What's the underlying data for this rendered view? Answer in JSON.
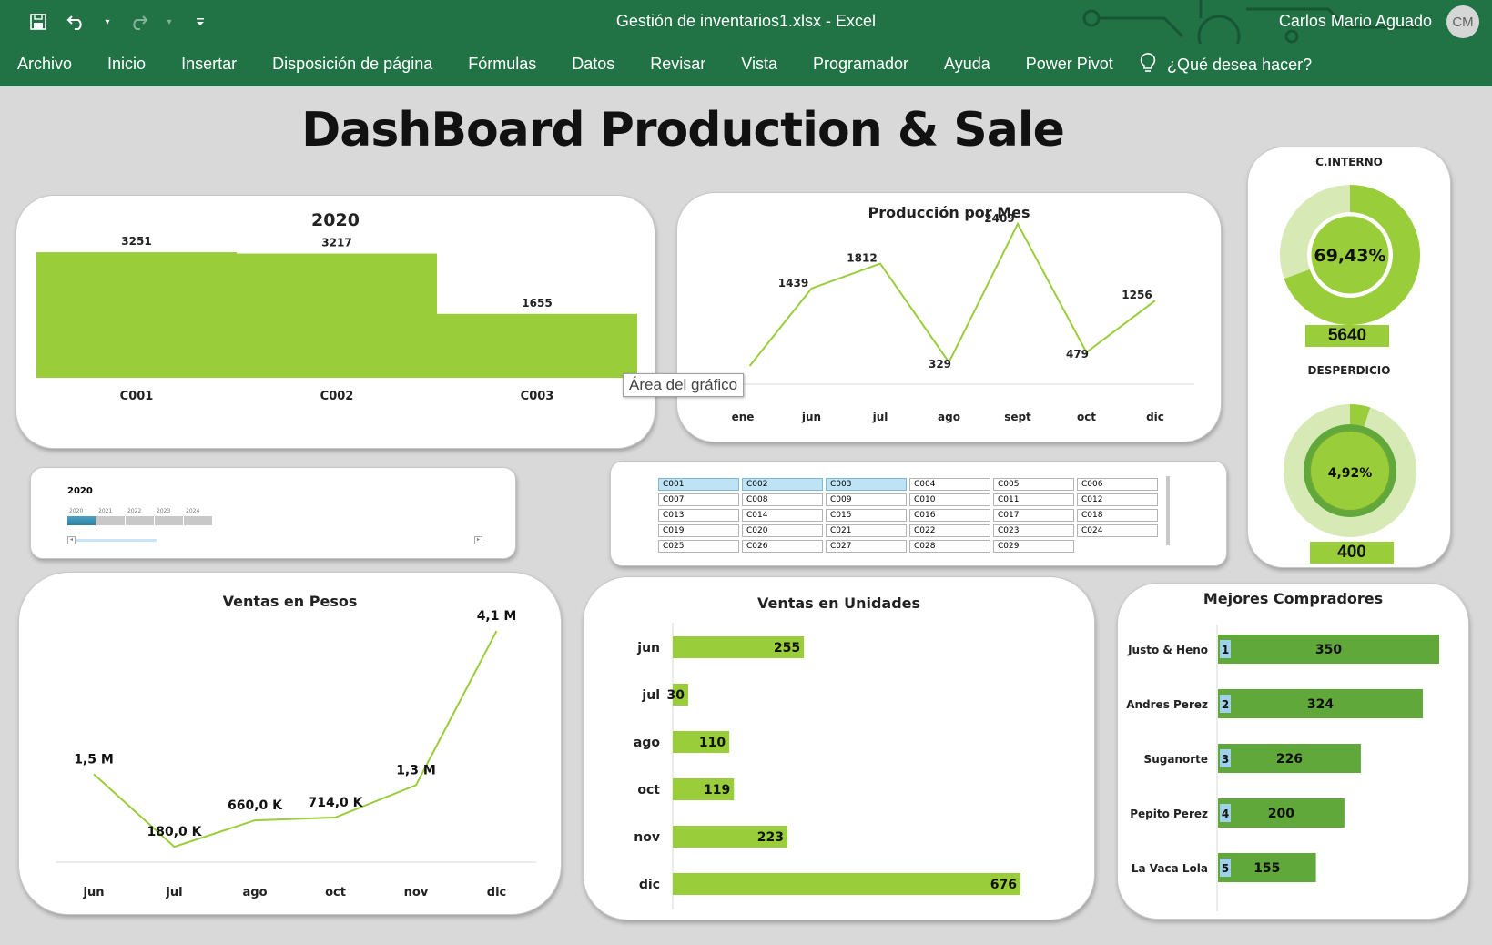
{
  "window": {
    "title": "Gestión de inventarios1.xlsx  -  Excel",
    "user": "Carlos Mario Aguado",
    "avatar": "CM"
  },
  "ribbon": {
    "tabs": [
      "Archivo",
      "Inicio",
      "Insertar",
      "Disposición de página",
      "Fórmulas",
      "Datos",
      "Revisar",
      "Vista",
      "Programador",
      "Ayuda",
      "Power Pivot"
    ],
    "tell_me": "¿Qué desea hacer?"
  },
  "icons": {
    "save": "save-icon",
    "undo": "undo-icon",
    "redo": "redo-icon",
    "customize": "customize-qat-icon",
    "lightbulb": "lightbulb-icon"
  },
  "dashboard": {
    "title": "DashBoard Production & Sale"
  },
  "tooltip": "Área del gráfico",
  "colors": {
    "green": "#9acd3a",
    "dark_green": "#60a83a",
    "light_green": "#d7e9b4",
    "ribbon": "#217346",
    "timeline_blue": "#3a91b4",
    "slicer_sel": "#bde3f5"
  },
  "gauges": {
    "interno": {
      "label": "C.INTERNO",
      "percent": "69,43%",
      "fraction": 0.6943,
      "value": "5640"
    },
    "desperdicio": {
      "label": "DESPERDICIO",
      "percent": "4,92%",
      "fraction": 0.0492,
      "value": "400"
    }
  },
  "timeline": {
    "selected": "2020",
    "years": [
      "2020",
      "2021",
      "2022",
      "2023",
      "2024"
    ]
  },
  "slicer": {
    "items": [
      "C001",
      "C002",
      "C003",
      "C004",
      "C005",
      "C006",
      "C007",
      "C008",
      "C009",
      "C010",
      "C011",
      "C012",
      "C013",
      "C014",
      "C015",
      "C016",
      "C017",
      "C018",
      "C019",
      "C020",
      "C021",
      "C022",
      "C023",
      "C024",
      "C025",
      "C026",
      "C027",
      "C028",
      "C029"
    ],
    "selected": [
      "C001",
      "C002",
      "C003"
    ]
  },
  "chart_data": [
    {
      "type": "bar",
      "title": "2020",
      "categories": [
        "C001",
        "C002",
        "C003"
      ],
      "values": [
        3251,
        3217,
        1655
      ],
      "ylim": [
        0,
        3300
      ]
    },
    {
      "type": "line",
      "title": "Producción por Mes",
      "categories": [
        "ene",
        "jun",
        "jul",
        "ago",
        "sept",
        "oct",
        "dic"
      ],
      "values": [
        null,
        1439,
        1812,
        329,
        2409,
        479,
        1256
      ],
      "labels": [
        "",
        "1439",
        "1812",
        "329",
        "2409",
        "479",
        "1256"
      ],
      "ylim": [
        0,
        2600
      ]
    },
    {
      "type": "line",
      "title": "Ventas en Pesos",
      "categories": [
        "jun",
        "jul",
        "ago",
        "oct",
        "nov",
        "dic"
      ],
      "values": [
        1500000,
        180000,
        660000,
        714000,
        1300000,
        4100000
      ],
      "labels": [
        "1,5 M",
        "180,0 K",
        "660,0 K",
        "714,0 K",
        "1,3 M",
        "4,1 M"
      ],
      "ylim": [
        0,
        4300000
      ]
    },
    {
      "type": "bar",
      "orientation": "horizontal",
      "title": "Ventas en Unidades",
      "categories": [
        "jun",
        "jul",
        "ago",
        "oct",
        "nov",
        "dic"
      ],
      "values": [
        255,
        30,
        110,
        119,
        223,
        676
      ],
      "xlim": [
        0,
        700
      ]
    },
    {
      "type": "bar",
      "orientation": "horizontal",
      "title": "Mejores Compradores",
      "categories": [
        "Justo & Heno",
        "Andres Perez",
        "Suganorte",
        "Pepito Perez",
        "La Vaca Lola"
      ],
      "ranks": [
        "1",
        "2",
        "3",
        "4",
        "5"
      ],
      "values": [
        350,
        324,
        226,
        200,
        155
      ],
      "xlim": [
        0,
        360
      ]
    }
  ]
}
